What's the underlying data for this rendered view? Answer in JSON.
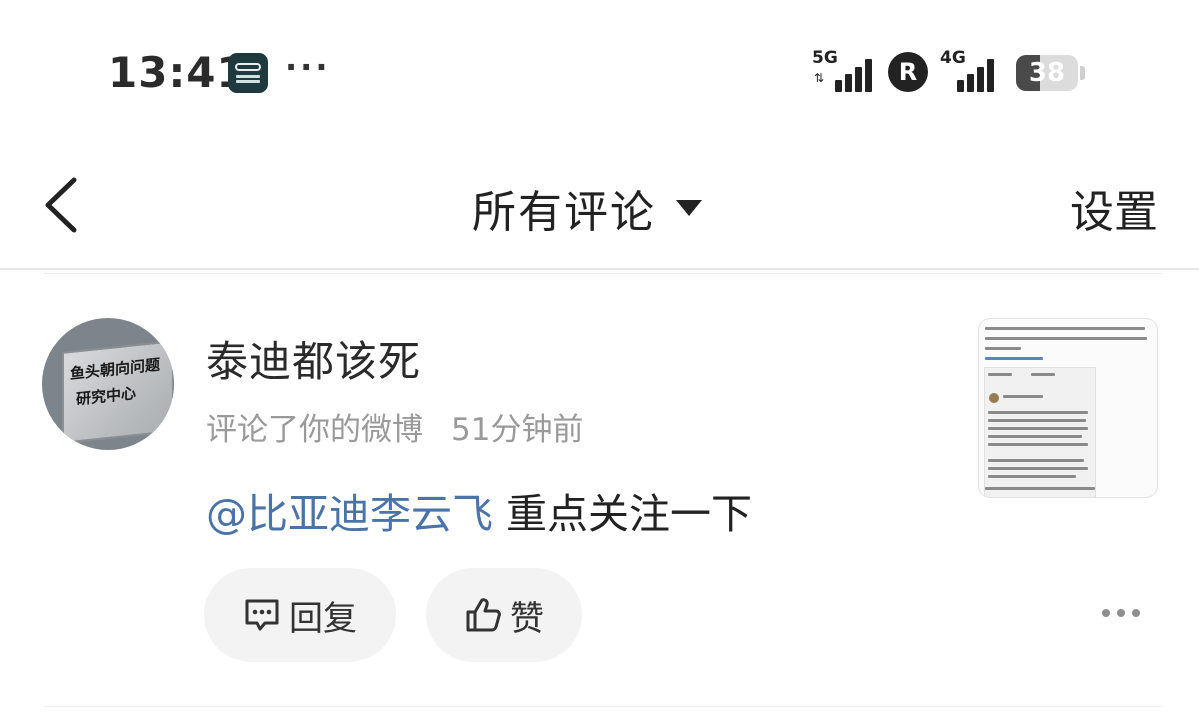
{
  "status_bar": {
    "time": "13:41",
    "app_icon": "gac-toyota-app-icon",
    "more_dots": "···",
    "signal_1_label": "5G",
    "roaming_label": "R",
    "signal_2_label": "4G",
    "battery_level": "38",
    "battery_percent": 38
  },
  "nav": {
    "back_icon": "chevron-left-icon",
    "title": "所有评论",
    "title_caret_icon": "caret-down-icon",
    "settings_label": "设置"
  },
  "comment": {
    "avatar_text_line1": "鱼头朝向问题",
    "avatar_text_line2": "研究中心",
    "username": "泰迪都该死",
    "action": "评论了你的微博",
    "timestamp": "51分钟前",
    "mention": "@比亚迪李云飞",
    "text": " 重点关注一下",
    "thumbnail_icon": "weibo-post-screenshot-thumbnail",
    "reply_label": "回复",
    "reply_icon": "comment-bubble-icon",
    "like_label": "赞",
    "like_icon": "thumbs-up-icon",
    "more_icon": "more-horizontal-icon"
  },
  "colors": {
    "mention": "#4a74a8",
    "meta_text": "#9a9a9a",
    "pill_bg": "#f3f3f3"
  }
}
